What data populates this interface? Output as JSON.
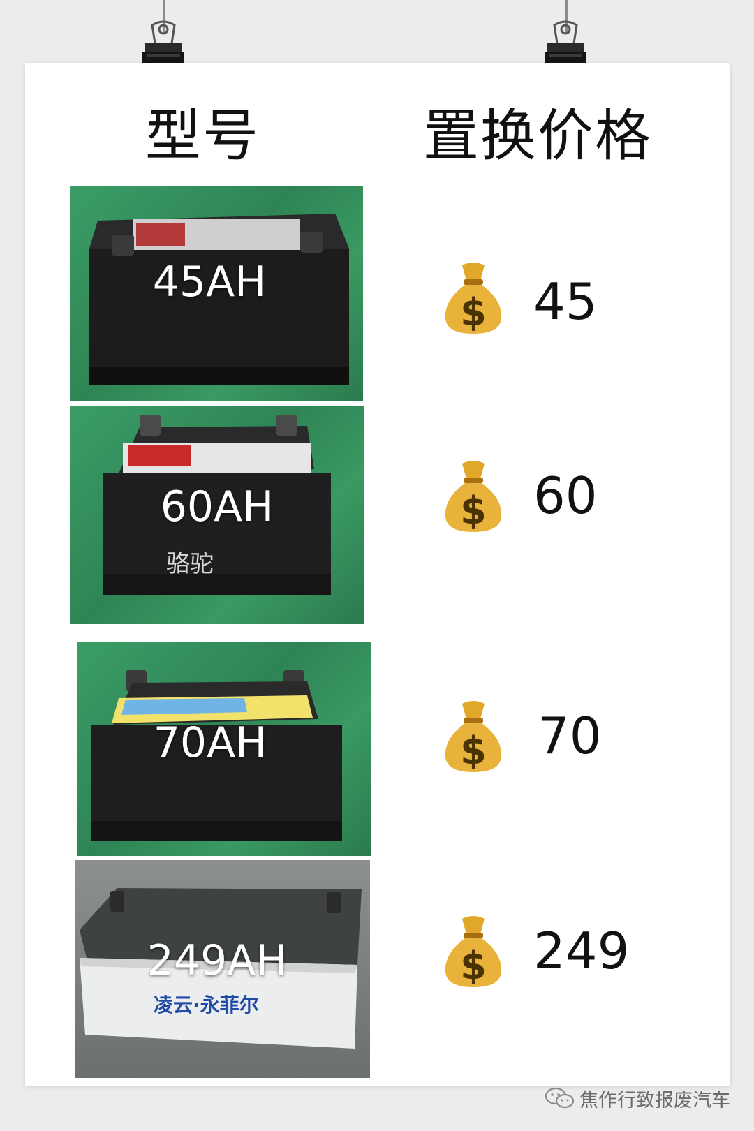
{
  "header": {
    "model_label": "型号",
    "price_label": "置换价格"
  },
  "items": [
    {
      "model": "45AH",
      "price": "45",
      "price_icon": "money-bag",
      "brand_text": ""
    },
    {
      "model": "60AH",
      "price": "60",
      "price_icon": "money-bag",
      "brand_text": "骆驼"
    },
    {
      "model": "70AH",
      "price": "70",
      "price_icon": "money-bag",
      "brand_text": ""
    },
    {
      "model": "249AH",
      "price": "249",
      "price_icon": "money-bag",
      "brand_text": "凌云·永菲尔"
    }
  ],
  "footer": {
    "account_name": "焦作行致报废汽车",
    "icon": "wechat-icon"
  },
  "colors": {
    "poster": "#ffffff",
    "background": "#ececec",
    "floor_green": "#2e8455",
    "text": "#111111",
    "caption": "#ffffff"
  }
}
